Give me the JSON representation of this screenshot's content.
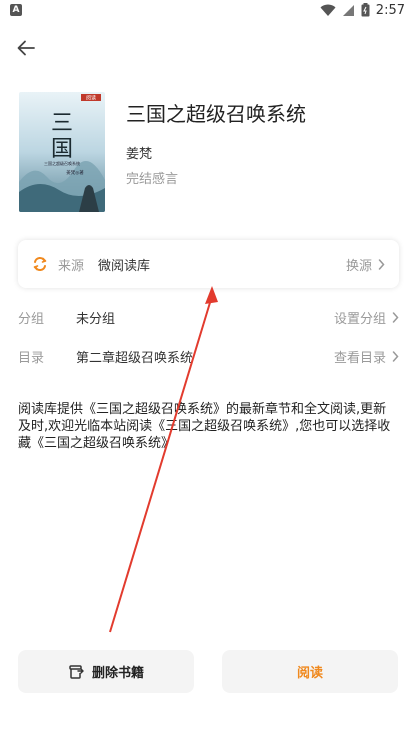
{
  "status_bar": {
    "app_letter": "A",
    "time": "2:57"
  },
  "book": {
    "title": "三国之超级召唤系统",
    "author": "姜梵",
    "status": "完结感言",
    "cover": {
      "badge": "阅读",
      "title_chars": [
        "三",
        "国"
      ],
      "subtitle": "三国之超级召唤系统",
      "author_line": "姜梵◎著"
    }
  },
  "source": {
    "label": "来源",
    "value": "微阅读库",
    "action": "换源"
  },
  "group": {
    "label": "分组",
    "value": "未分组",
    "action": "设置分组"
  },
  "toc": {
    "label": "目录",
    "value": "第二章超级召唤系统",
    "action": "查看目录"
  },
  "description": "阅读库提供《三国之超级召唤系统》的最新章节和全文阅读,更新及时,欢迎光临本站阅读《三国之超级召唤系统》,您也可以选择收藏《三国之超级召唤系统》",
  "buttons": {
    "delete": "删除书籍",
    "read": "阅读"
  },
  "colors": {
    "accent": "#f0891e",
    "annotation": "#e23b2e"
  }
}
